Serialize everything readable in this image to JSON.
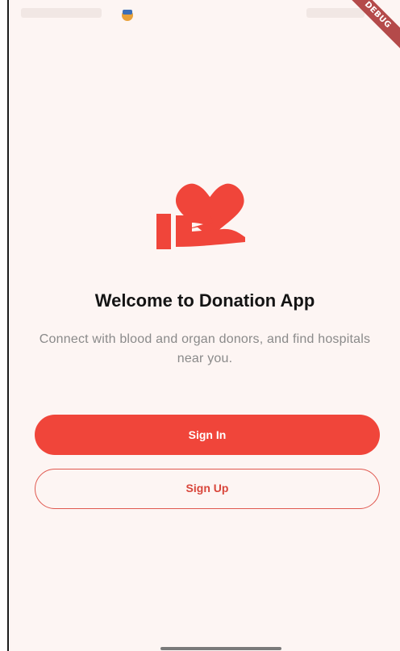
{
  "app": {
    "debug_badge": "DEBUG"
  },
  "welcome": {
    "title": "Welcome to Donation App",
    "subtitle": "Connect with blood and organ donors, and find hospitals near you.",
    "icon": "hand-holding-heart-icon"
  },
  "actions": {
    "sign_in_label": "Sign In",
    "sign_up_label": "Sign Up"
  },
  "colors": {
    "primary": "#f0453a",
    "background": "#fdf5f3",
    "title_text": "#141414",
    "subtitle_text": "#8a8a8a"
  }
}
